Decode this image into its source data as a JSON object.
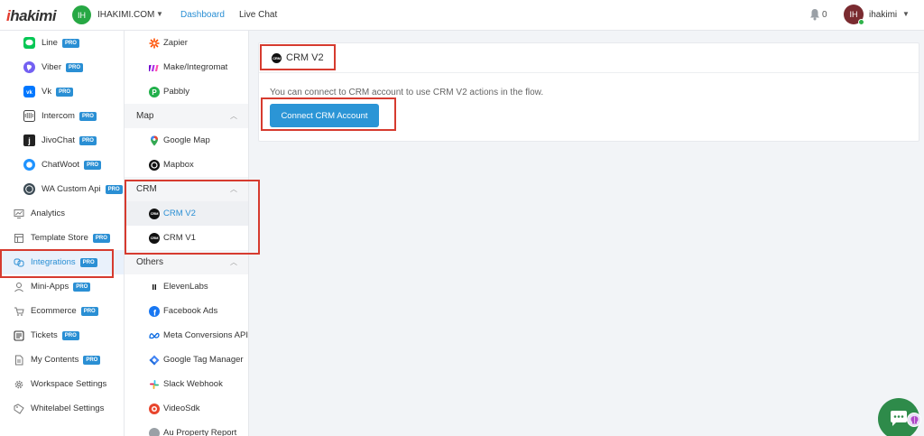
{
  "topbar": {
    "logo_prefix": "i",
    "logo_rest": "hakimi",
    "workspace_initials": "IH",
    "workspace_name": "IHAKIMI.COM",
    "nav": {
      "dashboard": "Dashboard",
      "live_chat": "Live Chat"
    },
    "notification_count": "0",
    "user_initials": "IH",
    "user_name": "ihakimi"
  },
  "sidebar": {
    "items": [
      {
        "label": "Line",
        "pro": "PRO",
        "icon": "line-icon"
      },
      {
        "label": "Viber",
        "pro": "PRO",
        "icon": "viber-icon"
      },
      {
        "label": "Vk",
        "pro": "PRO",
        "icon": "vk-icon"
      },
      {
        "label": "Intercom",
        "pro": "PRO",
        "icon": "intercom-icon"
      },
      {
        "label": "JivoChat",
        "pro": "PRO",
        "icon": "jivochat-icon"
      },
      {
        "label": "ChatWoot",
        "pro": "PRO",
        "icon": "chatwoot-icon"
      },
      {
        "label": "WA Custom Api",
        "pro": "PRO",
        "icon": "whatsapp-icon"
      },
      {
        "label": "Analytics",
        "pro": "",
        "icon": "analytics-icon"
      },
      {
        "label": "Template Store",
        "pro": "PRO",
        "icon": "template-store-icon"
      },
      {
        "label": "Integrations",
        "pro": "PRO",
        "icon": "integrations-icon"
      },
      {
        "label": "Mini-Apps",
        "pro": "PRO",
        "icon": "mini-apps-icon"
      },
      {
        "label": "Ecommerce",
        "pro": "PRO",
        "icon": "ecommerce-icon"
      },
      {
        "label": "Tickets",
        "pro": "PRO",
        "icon": "tickets-icon"
      },
      {
        "label": "My Contents",
        "pro": "PRO",
        "icon": "my-contents-icon"
      },
      {
        "label": "Workspace Settings",
        "pro": "",
        "icon": "workspace-settings-icon"
      },
      {
        "label": "Whitelabel Settings",
        "pro": "",
        "icon": "whitelabel-settings-icon"
      }
    ]
  },
  "panel": {
    "top_items": [
      {
        "label": "Zapier",
        "icon": "zapier-icon"
      },
      {
        "label": "Make/Integromat",
        "icon": "make-icon"
      },
      {
        "label": "Pabbly",
        "icon": "pabbly-icon"
      }
    ],
    "sections": {
      "map": {
        "title": "Map",
        "items": [
          {
            "label": "Google Map"
          },
          {
            "label": "Mapbox"
          }
        ]
      },
      "crm": {
        "title": "CRM",
        "items": [
          {
            "label": "CRM V2",
            "logo": "CRM"
          },
          {
            "label": "CRM V1",
            "logo": "CRM"
          }
        ]
      },
      "others": {
        "title": "Others",
        "items": [
          {
            "label": "ElevenLabs"
          },
          {
            "label": "Facebook Ads"
          },
          {
            "label": "Meta Conversions API"
          },
          {
            "label": "Google Tag Manager"
          },
          {
            "label": "Slack Webhook"
          },
          {
            "label": "VideoSdk"
          },
          {
            "label": "Au Property Report"
          }
        ]
      }
    }
  },
  "main": {
    "card_title": "CRM V2",
    "card_logo": "CRM",
    "description": "You can connect to CRM account to use CRM V2 actions in the flow.",
    "connect_button": "Connect CRM Account"
  },
  "colors": {
    "accent": "#2a8fd4",
    "button": "#2b95d6",
    "highlight_box": "#d63b2f",
    "workspace_avatar": "#27a844",
    "user_avatar": "#7a2b30",
    "chat_fab": "#2e8b4a"
  }
}
